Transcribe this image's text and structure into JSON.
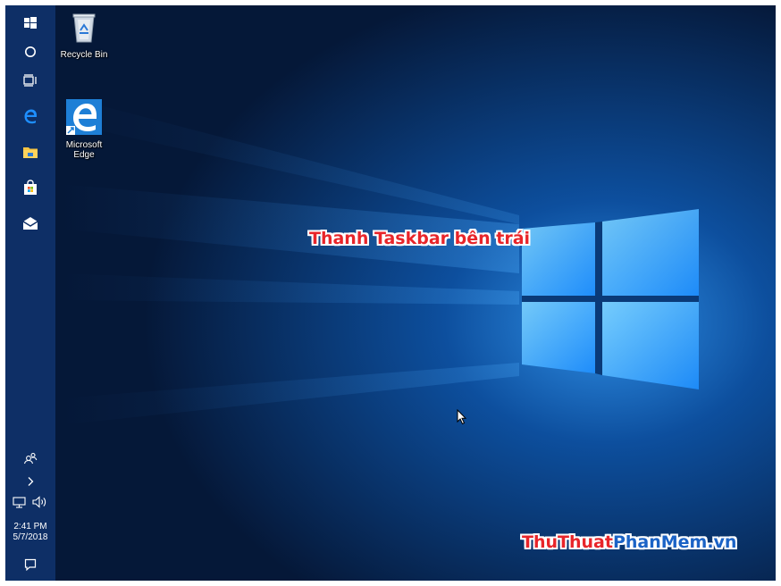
{
  "desktop": {
    "icons": [
      {
        "label": "Recycle Bin",
        "icon": "recycle-bin-icon"
      },
      {
        "label": "Microsoft\nEdge",
        "icon": "edge-icon"
      }
    ],
    "annotation": "Thanh Taskbar bên trái",
    "watermark": {
      "part1": "ThuThuat",
      "part2": "PhanMem",
      "part3": ".vn",
      "color1": "#e8252a",
      "color2": "#1b63c6"
    }
  },
  "taskbar": {
    "position": "left",
    "buttons": [
      "start-icon",
      "cortana-icon",
      "task-view-icon",
      "edge-icon",
      "file-explorer-icon",
      "store-icon",
      "mail-icon"
    ],
    "tray": {
      "people": "people-icon",
      "show_hidden": "chevron-right-icon",
      "network": "network-icon",
      "volume": "volume-icon",
      "time": "2:41 PM",
      "date": "5/7/2018",
      "action_center": "action-center-icon"
    },
    "color": "#0e2f66"
  },
  "colors": {
    "accent": "#1e8fff",
    "background": "#06204a"
  }
}
